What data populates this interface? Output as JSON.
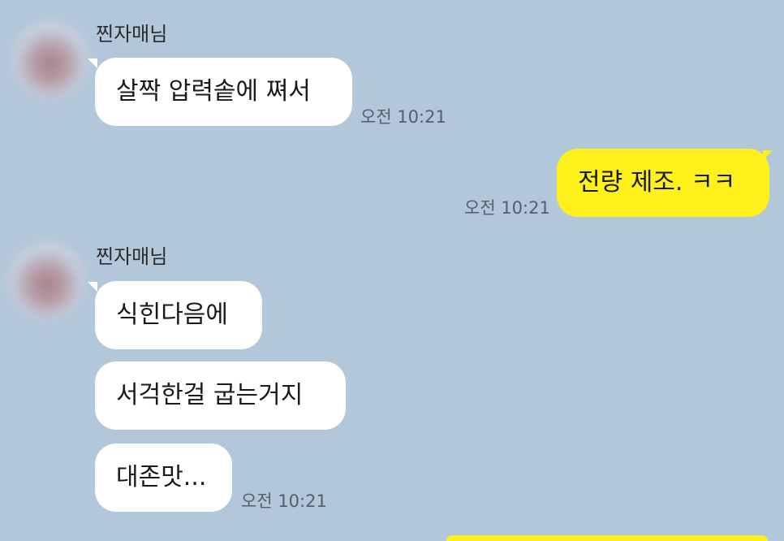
{
  "chat": {
    "messages": [
      {
        "sender": "찐자매님",
        "text": "살짝 압력솥에 쪄서",
        "time": "오전 10:21"
      },
      {
        "text": "전량 제조. ㅋㅋ",
        "time": "오전 10:21"
      },
      {
        "sender": "찐자매님",
        "text": "식힌다음에"
      },
      {
        "text": "서걱한걸 굽는거지"
      },
      {
        "text": "대존맛...",
        "time": "오전 10:21"
      }
    ]
  },
  "colors": {
    "background": "#b2c7d9",
    "incoming_bubble": "#ffffff",
    "outgoing_bubble": "#fef01b",
    "timestamp": "#55606b"
  }
}
